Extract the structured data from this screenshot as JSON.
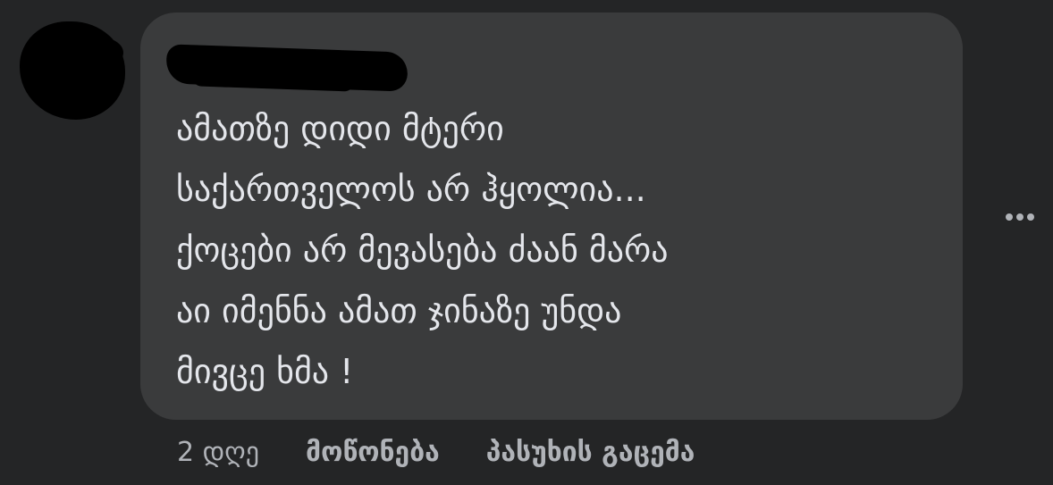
{
  "comment": {
    "lines": [
      "ამათზე დიდი მტერი",
      "საქართველოს არ ჰყოლია...",
      "ქოცები არ მევასება ძაან მარა",
      "აი იმენნა ამათ ჯინაზე უნდა",
      "მივცე ხმა !"
    ]
  },
  "meta": {
    "timestamp": "2 დღე",
    "like_label": "მოწონება",
    "reply_label": "პასუხის გაცემა"
  },
  "icons": {
    "more": "more-horizontal-icon"
  },
  "colors": {
    "background": "#242526",
    "bubble": "#3a3b3c",
    "text": "#e4e6eb",
    "meta_text": "#b0b3b8",
    "redaction": "#000000"
  }
}
